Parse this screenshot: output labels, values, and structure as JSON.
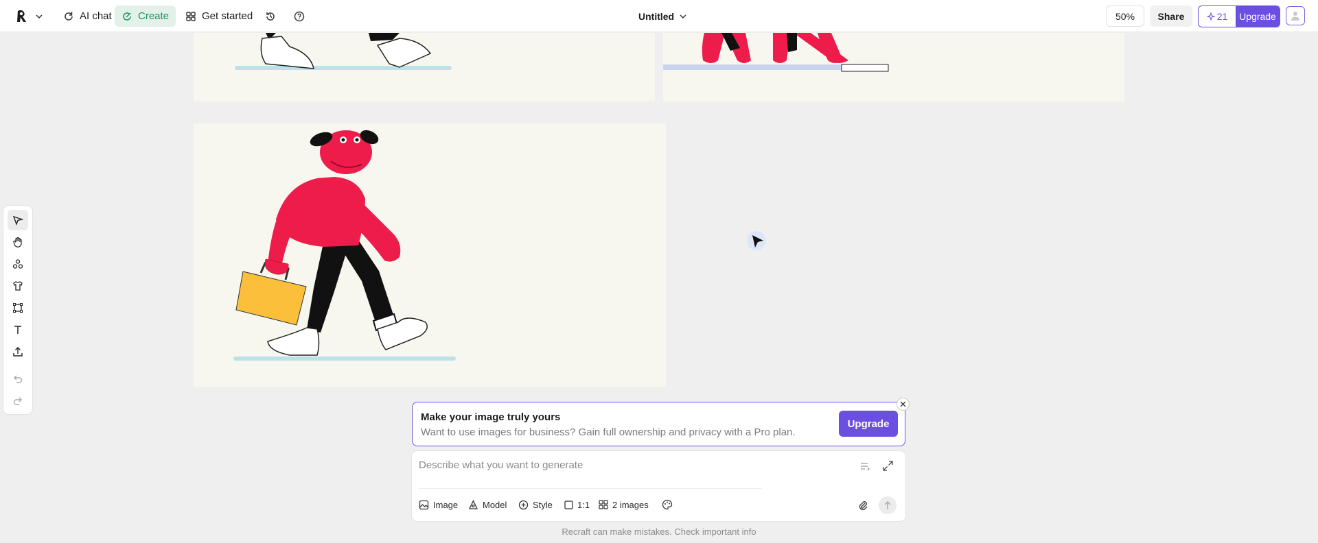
{
  "topbar": {
    "ai_chat": "AI chat",
    "create": "Create",
    "get_started": "Get started",
    "doc_title": "Untitled",
    "zoom": "50%",
    "share": "Share",
    "credits": "21",
    "upgrade": "Upgrade"
  },
  "toolbar": {
    "tools": [
      "select-tool",
      "hand-tool",
      "shapes-tool",
      "mockup-tool",
      "frame-tool",
      "text-tool",
      "upload-tool",
      "undo",
      "redo"
    ]
  },
  "banner": {
    "title": "Make your image truly yours",
    "subtitle": "Want to use images for business? Gain full ownership and privacy with a Pro plan.",
    "button": "Upgrade"
  },
  "prompt": {
    "placeholder": "Describe what you want to generate",
    "image": "Image",
    "model": "Model",
    "style": "Style",
    "ratio": "1:1",
    "count": "2 images"
  },
  "footer": "Recraft can make mistakes. Check important info",
  "colors": {
    "accent": "#6b4fe0",
    "create_bg": "#e2f2ea",
    "create_text": "#1d8f5a",
    "canvas": "#efefef",
    "card": "#f7f7ef",
    "character": "#ee1c4b",
    "briefcase": "#fbbf3c"
  }
}
